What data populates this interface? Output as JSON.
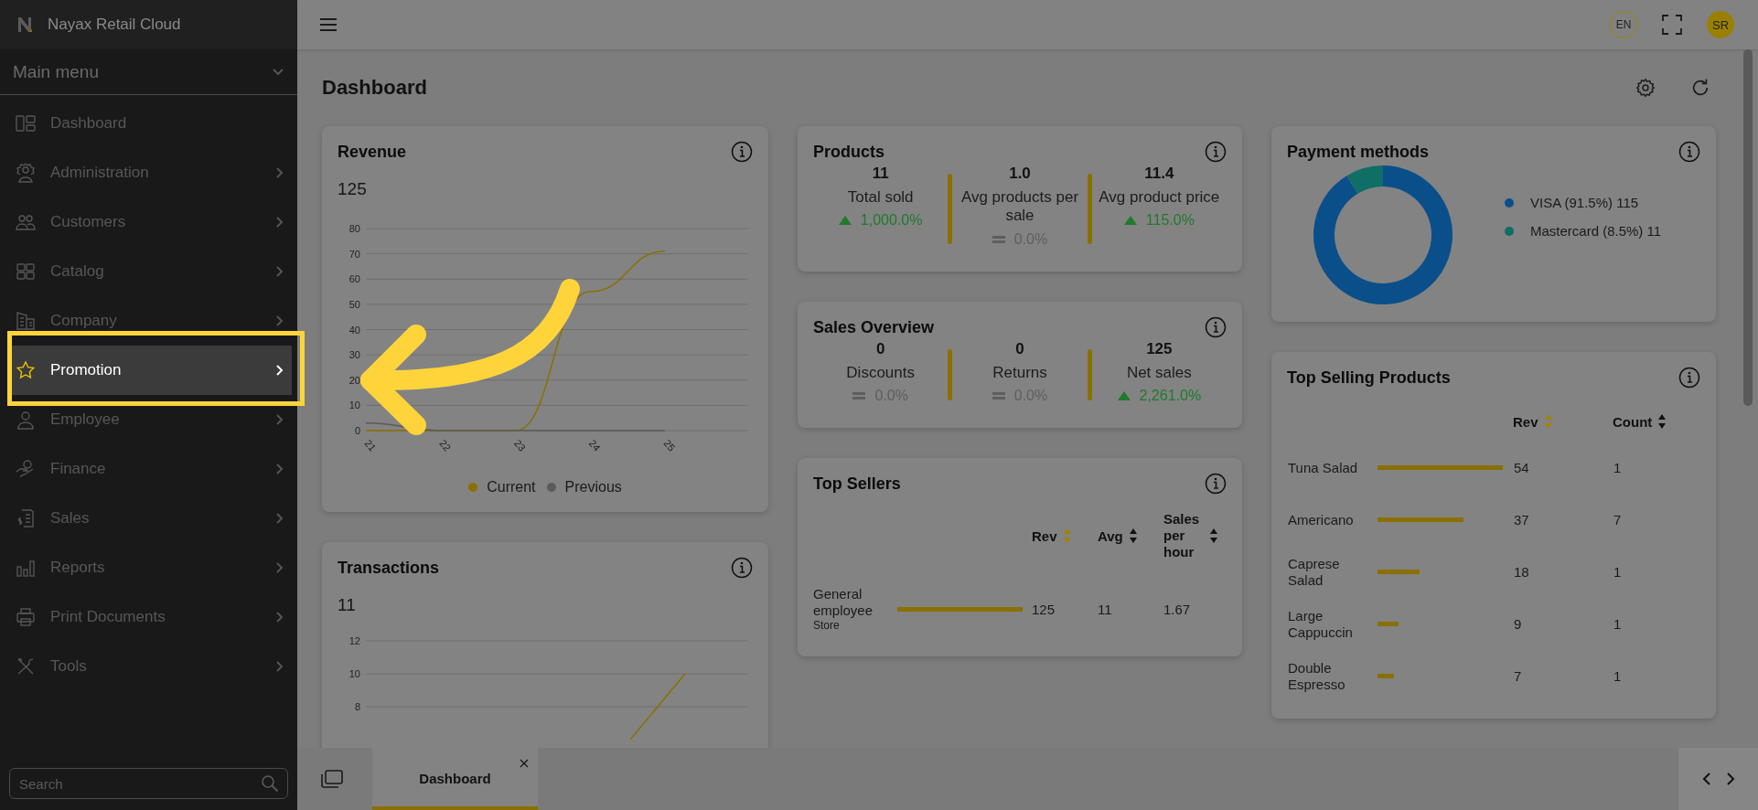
{
  "app": {
    "name": "Nayax Retail Cloud"
  },
  "sidebar": {
    "menu_title": "Main menu",
    "items": [
      {
        "label": "Dashboard",
        "selected": false,
        "has_submenu": false
      },
      {
        "label": "Administration",
        "selected": false,
        "has_submenu": true
      },
      {
        "label": "Customers",
        "selected": false,
        "has_submenu": true
      },
      {
        "label": "Catalog",
        "selected": false,
        "has_submenu": true
      },
      {
        "label": "Company",
        "selected": false,
        "has_submenu": true
      },
      {
        "label": "Promotion",
        "selected": true,
        "has_submenu": true
      },
      {
        "label": "Employee",
        "selected": false,
        "has_submenu": true
      },
      {
        "label": "Finance",
        "selected": false,
        "has_submenu": true
      },
      {
        "label": "Sales",
        "selected": false,
        "has_submenu": true
      },
      {
        "label": "Reports",
        "selected": false,
        "has_submenu": true
      },
      {
        "label": "Print Documents",
        "selected": false,
        "has_submenu": true
      },
      {
        "label": "Tools",
        "selected": false,
        "has_submenu": true
      }
    ],
    "search": {
      "placeholder": "Search"
    }
  },
  "topbar": {
    "language": "EN",
    "user_initials": "SR"
  },
  "page": {
    "title": "Dashboard"
  },
  "revenue": {
    "title": "Revenue",
    "value": "125",
    "chart_data": {
      "type": "line",
      "grid": true,
      "legend": "bottom",
      "categories": [
        "21",
        "22",
        "23",
        "24",
        "25"
      ],
      "ylim": [
        0,
        80
      ],
      "yticks": [
        0,
        10,
        20,
        30,
        40,
        50,
        60,
        70,
        80
      ],
      "series": [
        {
          "name": "Current",
          "color": "#8a7000",
          "values": [
            0,
            0,
            0,
            55,
            71
          ]
        },
        {
          "name": "Previous",
          "color": "#5a5a5a",
          "values": [
            3,
            0,
            0,
            0,
            0
          ]
        }
      ]
    }
  },
  "products": {
    "title": "Products",
    "stats": [
      {
        "value": "11",
        "label": "Total sold",
        "change": "1,000.0%",
        "kind": "up"
      },
      {
        "value": "1.0",
        "label": "Avg products per sale",
        "change": "0.0%",
        "kind": "flat"
      },
      {
        "value": "11.4",
        "label": "Avg product price",
        "change": "115.0%",
        "kind": "up"
      }
    ]
  },
  "sales_overview": {
    "title": "Sales Overview",
    "stats": [
      {
        "value": "0",
        "label": "Discounts",
        "change": "0.0%",
        "kind": "flat"
      },
      {
        "value": "0",
        "label": "Returns",
        "change": "0.0%",
        "kind": "flat"
      },
      {
        "value": "125",
        "label": "Net sales",
        "change": "2,261.0%",
        "kind": "up"
      }
    ]
  },
  "top_sellers": {
    "title": "Top Sellers",
    "columns": [
      {
        "label": "Rev",
        "sorted": true
      },
      {
        "label": "Avg",
        "sorted": false
      },
      {
        "label": "Sales per hour",
        "sorted": false
      }
    ],
    "rows": [
      {
        "name": "General employee",
        "subtitle": "Store",
        "cells": [
          "125",
          "11",
          "1.67"
        ]
      }
    ]
  },
  "payment_methods": {
    "title": "Payment methods",
    "slices": [
      {
        "color": "#0b4f8a"
      },
      {
        "color": "#0f6e66"
      }
    ],
    "chart_data": {
      "type": "donut",
      "legend": "right",
      "categories": [
        "VISA (91.5%) 115",
        "Mastercard (8.5%) 11"
      ],
      "values": [
        115,
        11
      ]
    }
  },
  "top_selling_products": {
    "title": "Top Selling Products",
    "columns": [
      {
        "label": "Rev",
        "sorted": true
      },
      {
        "label": "Count",
        "sorted": false
      }
    ],
    "rows": [
      {
        "name": "Tuna Salad",
        "cells": [
          "54",
          "1"
        ]
      },
      {
        "name": "Americano",
        "cells": [
          "37",
          "7"
        ]
      },
      {
        "name": "Caprese Salad",
        "cells": [
          "18",
          "1"
        ]
      },
      {
        "name": "Large Cappuccin",
        "cells": [
          "9",
          "1"
        ]
      },
      {
        "name": "Double Espresso",
        "cells": [
          "7",
          "1"
        ]
      }
    ]
  },
  "transactions": {
    "title": "Transactions",
    "value": "11",
    "axis_labels": [
      "12",
      "10",
      "8"
    ]
  },
  "tabs": [
    {
      "label": "Dashboard",
      "selected": true
    }
  ]
}
